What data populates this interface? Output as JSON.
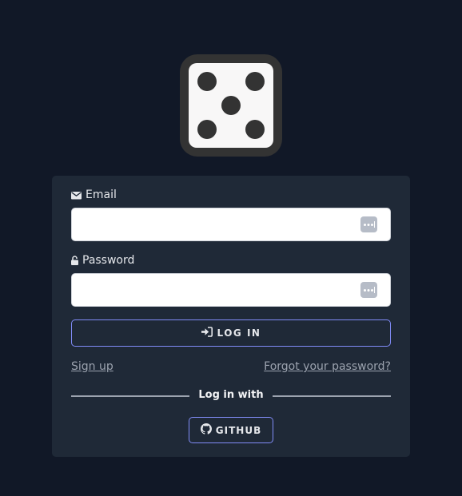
{
  "form": {
    "email_label": "Email",
    "email_value": "",
    "password_label": "Password",
    "password_value": "",
    "login_label": "LOG IN",
    "signup_label": "Sign up",
    "forgot_label": "Forgot your password?",
    "divider_label": "Log in with",
    "github_label": "GITHUB"
  },
  "icons": {
    "logo": "dice-five-icon",
    "email": "envelope-icon",
    "password": "unlock-icon",
    "password_manager": "password-manager-icon",
    "login": "sign-in-icon",
    "github": "github-icon"
  },
  "colors": {
    "background": "#111827",
    "card": "#1f2937",
    "accent_border": "#818cf8",
    "text": "#e5e7eb",
    "link": "#9ca3af"
  }
}
